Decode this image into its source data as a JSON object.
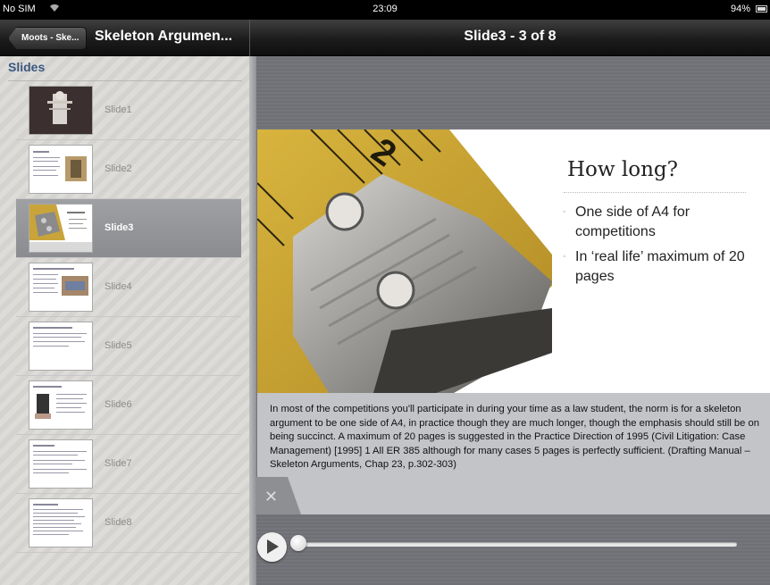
{
  "status_bar": {
    "carrier": "No SIM",
    "time": "23:09",
    "battery": "94%",
    "battery_level": 0.94
  },
  "nav": {
    "back_label": "Moots - Ske...",
    "document_title": "Skeleton Argumen...",
    "slide_position": "Slide3 - 3 of 8"
  },
  "sidebar": {
    "header": "Slides",
    "items": [
      {
        "label": "Slide1",
        "selected": false
      },
      {
        "label": "Slide2",
        "selected": false
      },
      {
        "label": "Slide3",
        "selected": true
      },
      {
        "label": "Slide4",
        "selected": false
      },
      {
        "label": "Slide5",
        "selected": false
      },
      {
        "label": "Slide6",
        "selected": false
      },
      {
        "label": "Slide7",
        "selected": false
      },
      {
        "label": "Slide8",
        "selected": false
      }
    ]
  },
  "slide": {
    "title": "How long?",
    "bullets": [
      "One side of A4 for competitions",
      "In ‘real life’ maximum of 20 pages"
    ]
  },
  "notes": {
    "text": "In most of the competitions you'll participate in during your time as a law student, the norm is for a skeleton argument to be one side of A4, in practice though they are much longer, though the emphasis should still be on being succinct. A maximum of 20 pages is suggested in the Practice Direction of 1995 (Civil Litigation: Case Management) [1995] 1 All ER 385 although for many cases 5 pages is perfectly sufficient. (Drafting Manual – Skeleton Arguments, Chap 23, p.302-303)",
    "close_icon": "close-icon"
  },
  "player": {
    "play_icon": "play-icon",
    "progress": 0.0
  },
  "colors": {
    "sidebar_header": "#3b5880",
    "selected_row": "#8f9195"
  }
}
